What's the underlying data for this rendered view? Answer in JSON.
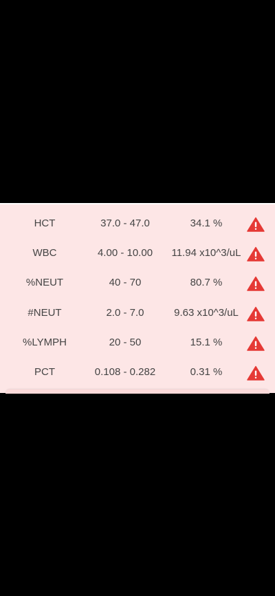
{
  "results": [
    {
      "name": "HCT",
      "range": "37.0 - 47.0",
      "value": "34.1 %"
    },
    {
      "name": "WBC",
      "range": "4.00 - 10.00",
      "value": "11.94 x10^3/uL"
    },
    {
      "name": "%NEUT",
      "range": "40 - 70",
      "value": "80.7 %"
    },
    {
      "name": "#NEUT",
      "range": "2.0 - 7.0",
      "value": "9.63 x10^3/uL"
    },
    {
      "name": "%LYMPH",
      "range": "20 - 50",
      "value": "15.1 %"
    },
    {
      "name": "PCT",
      "range": "0.108 - 0.282",
      "value": "0.31 %"
    }
  ],
  "icons": {
    "flag": "warning-triangle-icon"
  },
  "colors": {
    "panel_background": "#fde6e6",
    "warning": "#e53935",
    "text": "#444444",
    "screen_background": "#000000"
  }
}
